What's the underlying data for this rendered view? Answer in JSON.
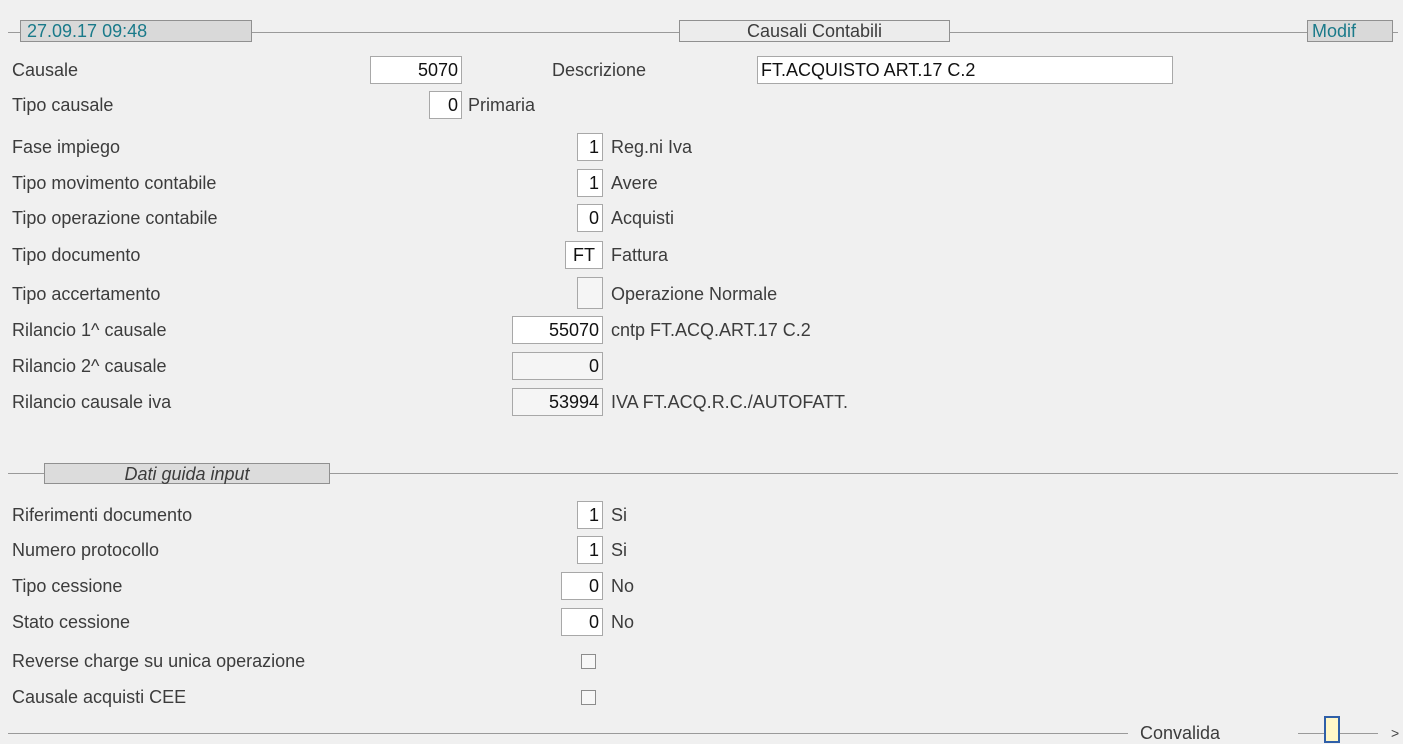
{
  "header": {
    "datetime": "27.09.17 09:48",
    "title": "Causali Contabili",
    "mode": "Modif"
  },
  "top": {
    "causale_label": "Causale",
    "causale_value": "5070",
    "descrizione_label": "Descrizione",
    "descrizione_value": "FT.ACQUISTO ART.17 C.2",
    "tipo_causale_label": "Tipo causale",
    "tipo_causale_value": "0",
    "tipo_causale_desc": "Primaria"
  },
  "rows": [
    {
      "label": "Fase impiego",
      "value": "1",
      "desc": "Reg.ni Iva"
    },
    {
      "label": "Tipo movimento contabile",
      "value": "1",
      "desc": "Avere"
    },
    {
      "label": "Tipo operazione contabile",
      "value": "0",
      "desc": "Acquisti"
    },
    {
      "label": "Tipo documento",
      "value": "FT",
      "desc": "Fattura"
    },
    {
      "label": "Tipo accertamento",
      "value": "",
      "desc": "Operazione Normale"
    },
    {
      "label": "Rilancio 1^ causale",
      "value": "55070",
      "desc": "cntp FT.ACQ.ART.17 C.2"
    },
    {
      "label": "Rilancio 2^ causale",
      "value": "0",
      "desc": ""
    },
    {
      "label": "Rilancio causale iva",
      "value": "53994",
      "desc": "IVA FT.ACQ.R.C./AUTOFATT."
    }
  ],
  "section": {
    "title": "Dati guida input"
  },
  "guide_rows": [
    {
      "label": "Riferimenti documento",
      "value": "1",
      "desc": "Si"
    },
    {
      "label": "Numero protocollo",
      "value": "1",
      "desc": "Si"
    },
    {
      "label": "Tipo cessione",
      "value": "0",
      "desc": "No"
    },
    {
      "label": "Stato cessione",
      "value": "0",
      "desc": "No"
    }
  ],
  "checks": [
    {
      "label": "Reverse charge su unica operazione",
      "checked": false
    },
    {
      "label": "Causale acquisti CEE",
      "checked": false
    }
  ],
  "footer": {
    "convalida_label": "Convalida",
    "arrow": ">"
  },
  "colors": {
    "background": "#f0f0f0",
    "teal_text": "#1a7a8a",
    "field_bg": "#ffffff"
  }
}
